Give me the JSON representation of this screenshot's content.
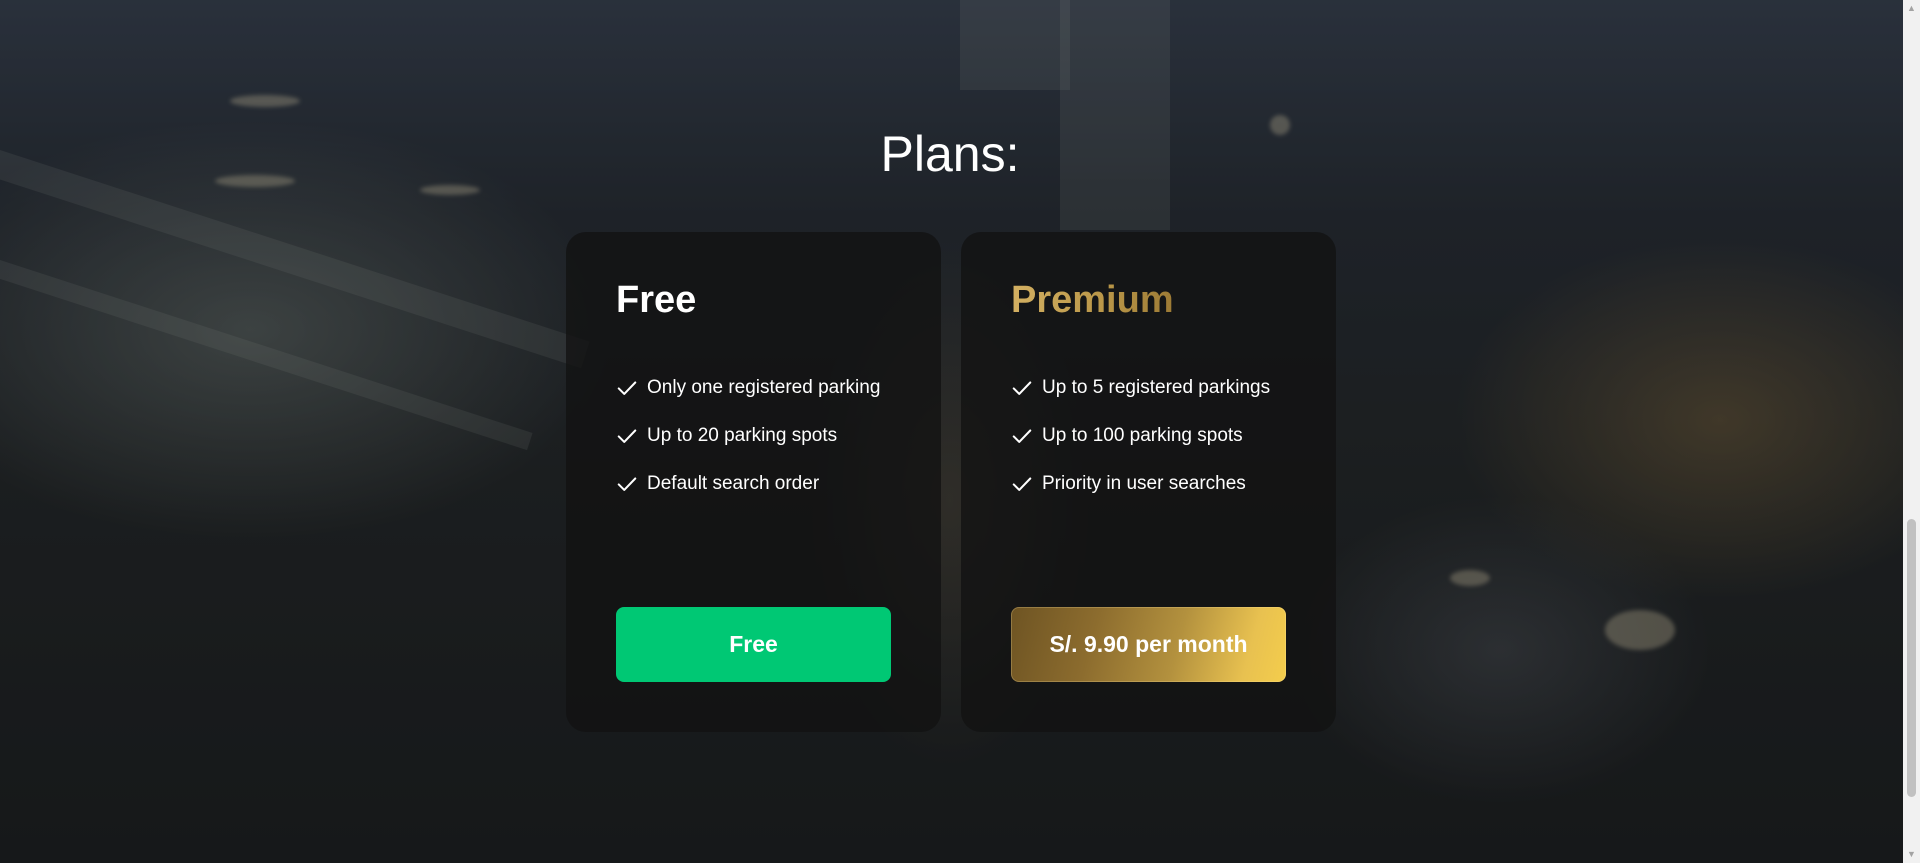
{
  "section": {
    "title": "Plans:"
  },
  "plans": [
    {
      "name": "Free",
      "features": [
        "Only one registered parking",
        "Up to 20 parking spots",
        "Default search order"
      ],
      "button_label": "Free",
      "accent": "#00c874"
    },
    {
      "name": "Premium",
      "features": [
        "Up to 5 registered parkings",
        "Up to 100 parking spots",
        "Priority in user searches"
      ],
      "button_label": "S/. 9.90 per month",
      "accent": "#d3b062"
    }
  ],
  "icons": {
    "feature": "check-icon",
    "scroll_up": "scroll-up-arrow-icon",
    "scroll_down": "scroll-down-arrow-icon"
  }
}
